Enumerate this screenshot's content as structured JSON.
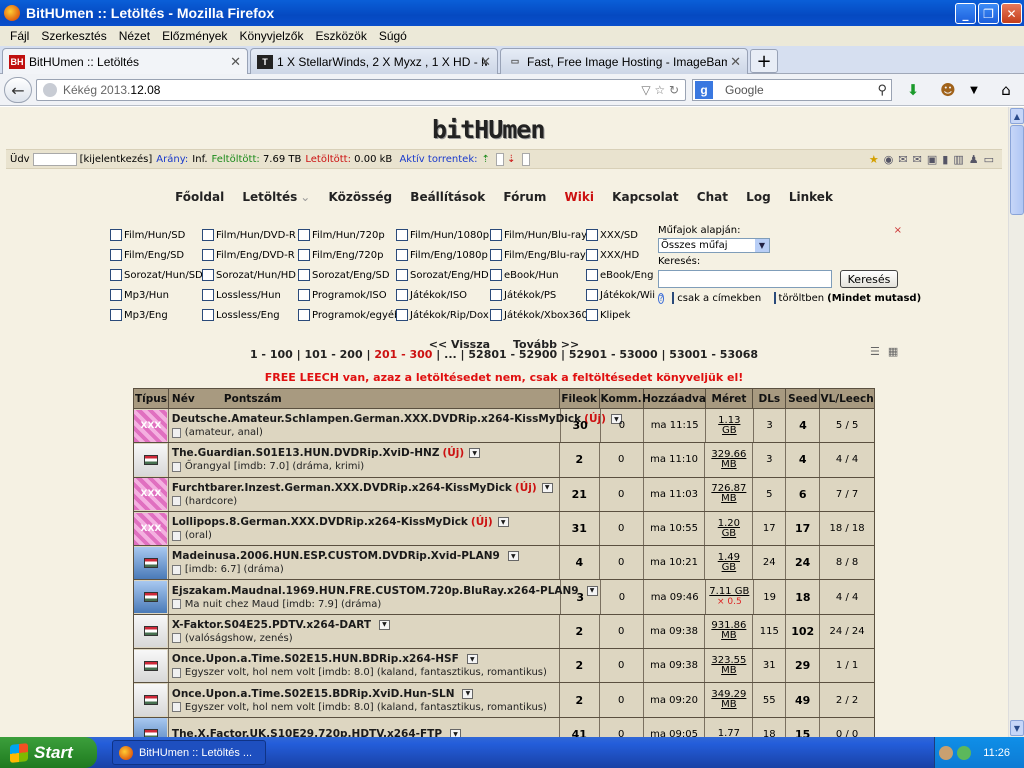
{
  "window": {
    "title": "BitHUmen :: Letöltés - Mozilla Firefox"
  },
  "menu": [
    "Fájl",
    "Szerkesztés",
    "Nézet",
    "Előzmények",
    "Könyvjelzők",
    "Eszközök",
    "Súgó"
  ],
  "tabs": [
    {
      "label": "BitHUmen :: Letöltés"
    },
    {
      "label": "1 X StellarWinds, 2 X Myxz , 1 X HD - MK..."
    },
    {
      "label": "Fast, Free Image Hosting - ImageBam"
    }
  ],
  "nav": {
    "url_prefix": "Kékég 2013.",
    "url_bold": "12.08",
    "search_placeholder": "Google"
  },
  "site": {
    "logo": "bitHUmen",
    "status": {
      "udv": "Üdv",
      "logout": "[kijelentkezés]",
      "arany_label": "Arány:",
      "arany_value": "Inf.",
      "feltoltott_label": "Feltöltött:",
      "feltoltott_value": "7.69 TB",
      "letoltott_label": "Letöltött:",
      "letoltott_value": "0.00 kB",
      "aktiv": "Aktív torrentek:"
    },
    "mainnav": [
      "Főoldal",
      "Letöltés",
      "Közösség",
      "Beállítások",
      "Fórum",
      "Wiki",
      "Kapcsolat",
      "Chat",
      "Log",
      "Linkek"
    ]
  },
  "categories": [
    [
      "Film/Hun/SD",
      "Film/Hun/DVD-R",
      "Film/Hun/720p",
      "Film/Hun/1080p",
      "Film/Hun/Blu-ray",
      "XXX/SD"
    ],
    [
      "Film/Eng/SD",
      "Film/Eng/DVD-R",
      "Film/Eng/720p",
      "Film/Eng/1080p",
      "Film/Eng/Blu-ray",
      "XXX/HD"
    ],
    [
      "Sorozat/Hun/SD",
      "Sorozat/Hun/HD",
      "Sorozat/Eng/SD",
      "Sorozat/Eng/HD",
      "eBook/Hun",
      "eBook/Eng"
    ],
    [
      "Mp3/Hun",
      "Lossless/Hun",
      "Programok/ISO",
      "Játékok/ISO",
      "Játékok/PS",
      "Játékok/Wii"
    ],
    [
      "Mp3/Eng",
      "Lossless/Eng",
      "Programok/egyéb",
      "Játékok/Rip/Dox",
      "Játékok/Xbox360",
      "Klipek"
    ]
  ],
  "filter": {
    "genre_label": "Műfajok alapján:",
    "genre_value": "Összes műfaj",
    "search_label": "Keresés:",
    "search_button": "Keresés",
    "only_names": "csak a címekben",
    "deleted": "töröltben",
    "show_all": "(Mindet mutasd)",
    "close": "×"
  },
  "pager": {
    "prev": "<< Vissza",
    "next": "Tovább >>",
    "pages": [
      "1 - 100",
      "101 - 200",
      "201 - 300",
      "...",
      "52801 - 52900",
      "52901 - 53000",
      "53001 - 53068"
    ],
    "current": "201 - 300"
  },
  "freeleech": "FREE LEECH van, azaz a letöltésedet nem, csak a feltöltésedet könyveljük el!",
  "table": {
    "headers": [
      "Típus",
      "Név",
      "Pontszám",
      "Fileok",
      "Komm.",
      "Hozzáadva",
      "Méret",
      "DLs",
      "Seed",
      "VL/Leech"
    ],
    "rows": [
      {
        "type": "xxx",
        "name": "Deutsche.Amateur.Schlampen.German.XXX.DVDRip.x264-KissMyDick",
        "uj": "(Új)",
        "sub": "(amateur, anal)",
        "files": "30",
        "comm": "0",
        "added": "ma 11:15",
        "size1": "1.13",
        "size2": "GB",
        "dls": "3",
        "seed": "4",
        "vl": "5 / 5"
      },
      {
        "type": "tv",
        "name": "The.Guardian.S01E13.HUN.DVDRip.XviD-HNZ",
        "uj": "(Új)",
        "sub": "Őrangyal [imdb: 7.0] (dráma, krimi)",
        "files": "2",
        "comm": "0",
        "added": "ma 11:10",
        "size1": "329.66",
        "size2": "MB",
        "dls": "3",
        "seed": "4",
        "vl": "4 / 4"
      },
      {
        "type": "xxx",
        "name": "Furchtbarer.Inzest.German.XXX.DVDRip.x264-KissMyDick",
        "uj": "(Új)",
        "sub": "(hardcore)",
        "files": "21",
        "comm": "0",
        "added": "ma 11:03",
        "size1": "726.87",
        "size2": "MB",
        "dls": "5",
        "seed": "6",
        "vl": "7 / 7"
      },
      {
        "type": "xxx",
        "name": "Lollipops.8.German.XXX.DVDRip.x264-KissMyDick",
        "uj": "(Új)",
        "sub": "(oral)",
        "files": "31",
        "comm": "0",
        "added": "ma 10:55",
        "size1": "1.20",
        "size2": "GB",
        "dls": "17",
        "seed": "17",
        "vl": "18 / 18"
      },
      {
        "type": "film",
        "name": "Madeinusa.2006.HUN.ESP.CUSTOM.DVDRip.Xvid-PLAN9",
        "uj": "",
        "sub": "[imdb: 6.7] (dráma)",
        "files": "4",
        "comm": "0",
        "added": "ma 10:21",
        "size1": "1.49",
        "size2": "GB",
        "dls": "24",
        "seed": "24",
        "vl": "8 / 8"
      },
      {
        "type": "film",
        "name": "Ejszakam.Maudnal.1969.HUN.FRE.CUSTOM.720p.BluRay.x264-PLAN9",
        "uj": "",
        "sub": "Ma nuit chez Maud [imdb: 7.9] (dráma)",
        "files": "3",
        "comm": "0",
        "added": "ma 09:46",
        "size1": "7.11 GB",
        "size2": "× 0.5",
        "dls": "19",
        "seed": "18",
        "vl": "4 / 4"
      },
      {
        "type": "tv",
        "name": "X-Faktor.S04E25.PDTV.x264-DART",
        "uj": "",
        "sub": "(valóságshow, zenés)",
        "files": "2",
        "comm": "0",
        "added": "ma 09:38",
        "size1": "931.86",
        "size2": "MB",
        "dls": "115",
        "seed": "102",
        "vl": "24 / 24"
      },
      {
        "type": "tv",
        "name": "Once.Upon.a.Time.S02E15.HUN.BDRip.x264-HSF",
        "uj": "",
        "sub": "Egyszer volt, hol nem volt [imdb: 8.0] (kaland, fantasztikus, romantikus)",
        "files": "2",
        "comm": "0",
        "added": "ma 09:38",
        "size1": "323.55",
        "size2": "MB",
        "dls": "31",
        "seed": "29",
        "vl": "1 / 1"
      },
      {
        "type": "tv",
        "name": "Once.Upon.a.Time.S02E15.BDRip.XviD.Hun-SLN",
        "uj": "",
        "sub": "Egyszer volt, hol nem volt [imdb: 8.0] (kaland, fantasztikus, romantikus)",
        "files": "2",
        "comm": "0",
        "added": "ma 09:20",
        "size1": "349.29",
        "size2": "MB",
        "dls": "55",
        "seed": "49",
        "vl": "2 / 2"
      },
      {
        "type": "film",
        "name": "The.X.Factor.UK.S10E29.720p.HDTV.x264-FTP",
        "uj": "",
        "sub": "",
        "files": "41",
        "comm": "0",
        "added": "ma 09:05",
        "size1": "1.77",
        "size2": "",
        "dls": "18",
        "seed": "15",
        "vl": "0 / 0"
      }
    ]
  },
  "taskbar": {
    "start": "Start",
    "item": "BitHUmen :: Letöltés ...",
    "clock": "11:26"
  }
}
